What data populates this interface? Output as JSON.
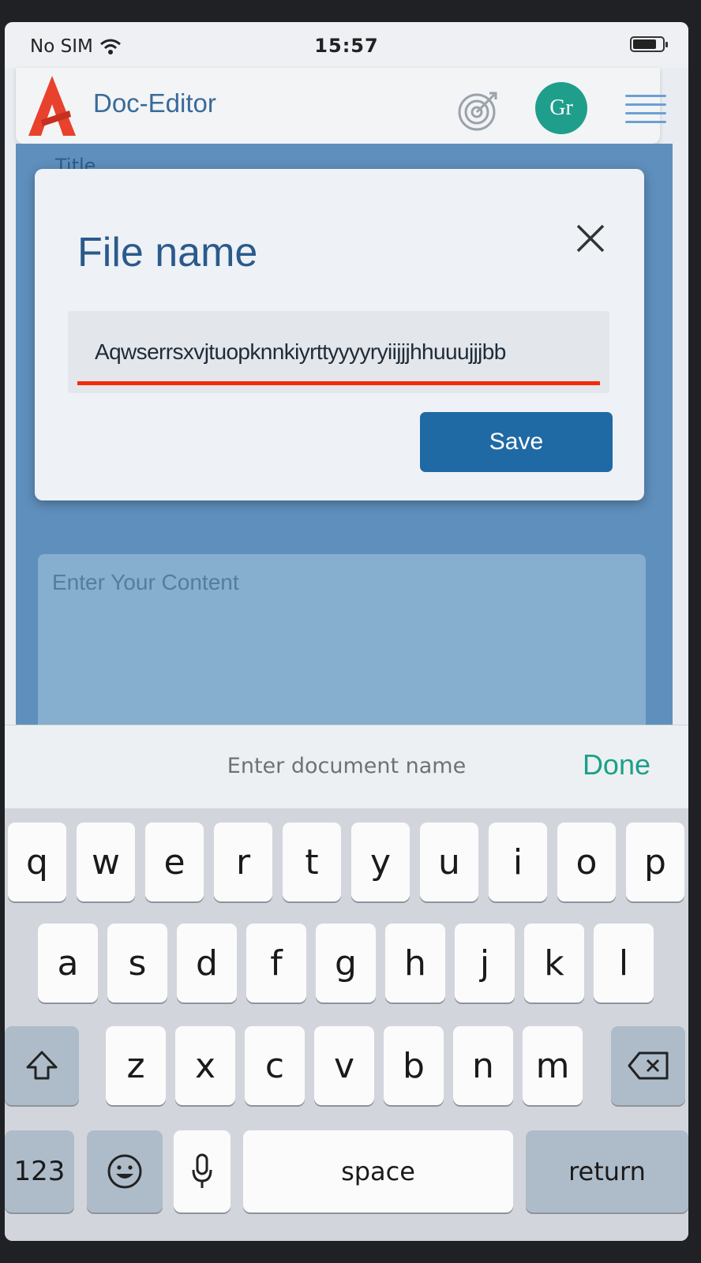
{
  "status": {
    "carrier": "No SIM",
    "time": "15:57",
    "battery_level": 0.8
  },
  "header": {
    "app_title": "Doc-Editor",
    "avatar_initials": "Gr"
  },
  "background": {
    "title_label": "Title",
    "content_placeholder": "Enter Your Content"
  },
  "modal": {
    "title": "File name",
    "file_name_value": "Aqwserrsxvjtuopknnkiyrttyyyyryiijjjhhuuujjjbb",
    "save_label": "Save"
  },
  "accessory": {
    "placeholder": "Enter document name",
    "done_label": "Done"
  },
  "keyboard": {
    "row1": [
      "q",
      "w",
      "e",
      "r",
      "t",
      "y",
      "u",
      "i",
      "o",
      "p"
    ],
    "row2": [
      "a",
      "s",
      "d",
      "f",
      "g",
      "h",
      "j",
      "k",
      "l"
    ],
    "row3": [
      "z",
      "x",
      "c",
      "v",
      "b",
      "n",
      "m"
    ],
    "numbers_label": "123",
    "space_label": "space",
    "return_label": "return"
  },
  "colors": {
    "accent": "#1f6aa5",
    "underline": "#f22b0a",
    "done": "#1aa08a",
    "avatar": "#1f9e8c"
  }
}
